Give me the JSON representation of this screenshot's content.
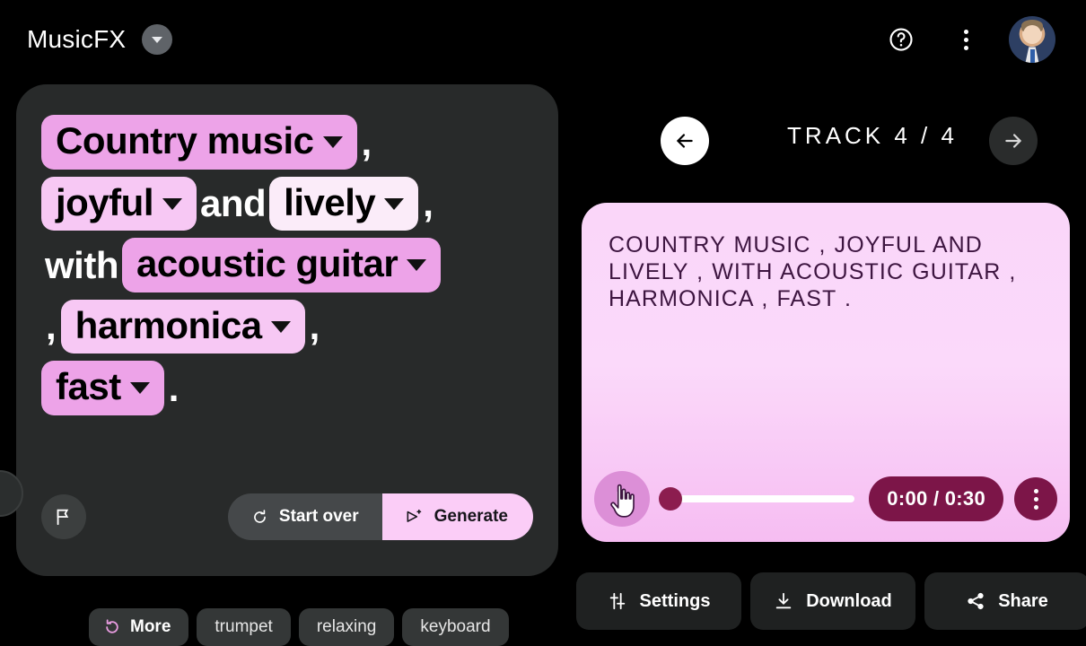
{
  "app": {
    "brand_title": "MusicFX",
    "brand_caret_icon": "chevron-down-icon",
    "help_icon": "help-circle-icon",
    "overflow_icon": "more-vertical-icon",
    "avatar_icon": "user-avatar"
  },
  "prompt": {
    "tokens": [
      {
        "type": "chip",
        "label": "Country music",
        "shade": "#eda3e8"
      },
      {
        "type": "punct",
        "label": ","
      },
      {
        "type": "chip",
        "label": "joyful",
        "shade": "#f7c8f4"
      },
      {
        "type": "connector",
        "label": "and"
      },
      {
        "type": "chip",
        "label": "lively",
        "shade": "#fbecf9"
      },
      {
        "type": "punct",
        "label": ","
      },
      {
        "type": "connector",
        "label": "with"
      },
      {
        "type": "chip",
        "label": "acoustic guitar",
        "shade": "#eda3e8"
      },
      {
        "type": "punct",
        "label": ","
      },
      {
        "type": "chip",
        "label": "harmonica",
        "shade": "#f7c8f4"
      },
      {
        "type": "punct",
        "label": ","
      },
      {
        "type": "chip",
        "label": "fast",
        "shade": "#eda3e8"
      },
      {
        "type": "punct",
        "label": "."
      }
    ],
    "flag_icon": "flag-icon",
    "start_over_label": "Start over",
    "start_over_icon": "refresh-icon",
    "generate_label": "Generate",
    "generate_icon": "send-sparkle-icon"
  },
  "suggestions": {
    "more_label": "More",
    "more_icon": "refresh-cw-icon",
    "items": [
      {
        "label": "trumpet"
      },
      {
        "label": "relaxing"
      },
      {
        "label": "keyboard"
      }
    ]
  },
  "track": {
    "prev_icon": "arrow-left-icon",
    "next_icon": "arrow-right-icon",
    "label": "TRACK  4 / 4",
    "current": 4,
    "total": 4,
    "prompt_text": "COUNTRY MUSIC , JOYFUL AND LIVELY , WITH ACOUSTIC GUITAR , HARMONICA , FAST .",
    "player": {
      "play_icon": "play-icon",
      "progress_percent": 0,
      "time_label": "0:00 / 0:30",
      "current_time": "0:00",
      "duration": "0:30",
      "overflow_icon": "more-vertical-icon"
    }
  },
  "actions": [
    {
      "label": "Settings",
      "icon": "tune-icon"
    },
    {
      "label": "Download",
      "icon": "download-icon"
    },
    {
      "label": "Share",
      "icon": "share-icon"
    }
  ],
  "colors": {
    "page_bg": "#000000",
    "card_bg": "#282a2a",
    "accent_pink": "#fbcdf7",
    "track_card_top": "#fad6f9",
    "track_card_bottom": "#f6bdf2",
    "pill_maroon": "#7c1548"
  }
}
